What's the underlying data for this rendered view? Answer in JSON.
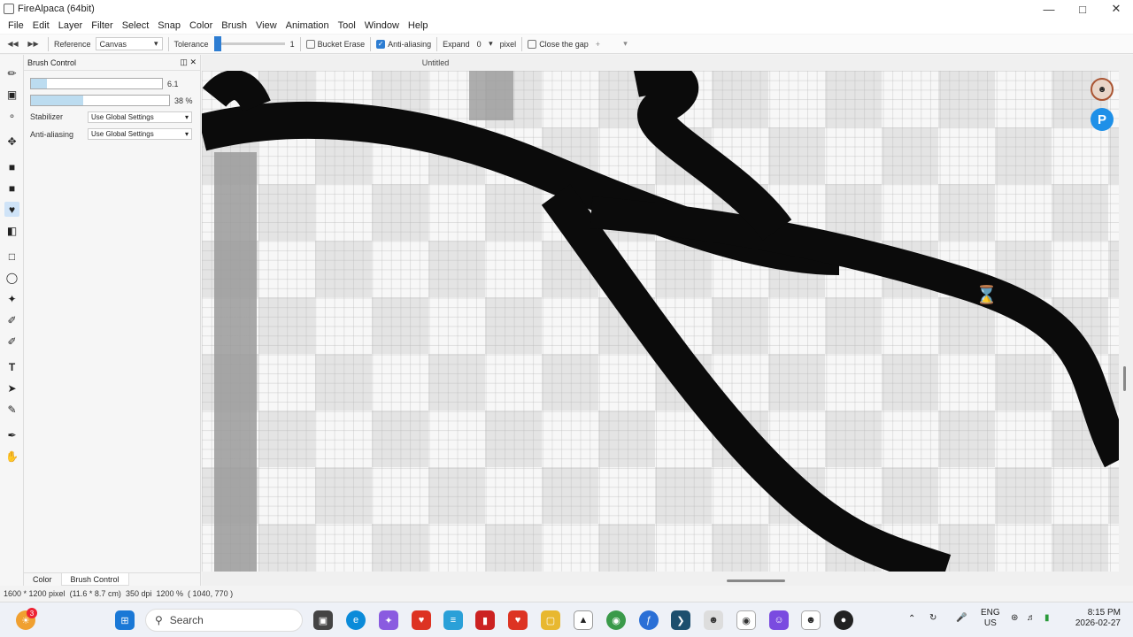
{
  "window": {
    "title": "FireAlpaca (64bit)"
  },
  "menu": [
    "File",
    "Edit",
    "Layer",
    "Filter",
    "Select",
    "Snap",
    "Color",
    "Brush",
    "View",
    "Animation",
    "Tool",
    "Window",
    "Help"
  ],
  "toolbar": {
    "reference_label": "Reference",
    "reference_value": "Canvas",
    "tolerance_label": "Tolerance",
    "tolerance_value": "1",
    "bucket_erase_label": "Bucket Erase",
    "bucket_erase_checked": false,
    "antialiasing_label": "Anti-aliasing",
    "antialiasing_checked": true,
    "expand_label": "Expand",
    "expand_value": "0",
    "pixel_label": "pixel",
    "close_gap_label": "Close the gap",
    "close_gap_value": "+"
  },
  "brush_panel": {
    "title": "Brush Control",
    "size_value": "6.1",
    "size_fraction": 0.12,
    "opacity_value": "38 %",
    "opacity_fraction": 0.38,
    "stabilizer_label": "Stabilizer",
    "stabilizer_value": "Use Global Settings",
    "antialiasing_label": "Anti-aliasing",
    "antialiasing_value": "Use Global Settings",
    "tabs": [
      "Color",
      "Brush Control"
    ],
    "active_tab": "Brush Control"
  },
  "tools": [
    "brush-icon",
    "eraser-icon",
    "dot-icon",
    "move-icon",
    "fill-shape-icon",
    "bucket-icon",
    "gradient-icon",
    "select-rect-icon",
    "lasso-icon",
    "magic-wand-icon",
    "select-pen-icon",
    "select-eraser-icon",
    "text-icon",
    "operation-icon",
    "dividing-icon",
    "eyedropper-icon",
    "hand-icon"
  ],
  "active_tool": "bucket-icon",
  "canvas": {
    "document_title": "Untitled"
  },
  "status": {
    "size": "1600 * 1200 pixel",
    "physical": "(11.6 * 8.7 cm)",
    "dpi": "350 dpi",
    "zoom": "1200 %",
    "cursor": "( 1040, 770 )"
  },
  "taskbar": {
    "search_placeholder": "Search",
    "notification_count": "3",
    "lang_top": "ENG",
    "lang_bottom": "US",
    "time": "8:15 PM",
    "date": "2026-02-27",
    "colors": {
      "accent": "#2d7dd2",
      "brush_fill": "#bcdcf0"
    }
  }
}
